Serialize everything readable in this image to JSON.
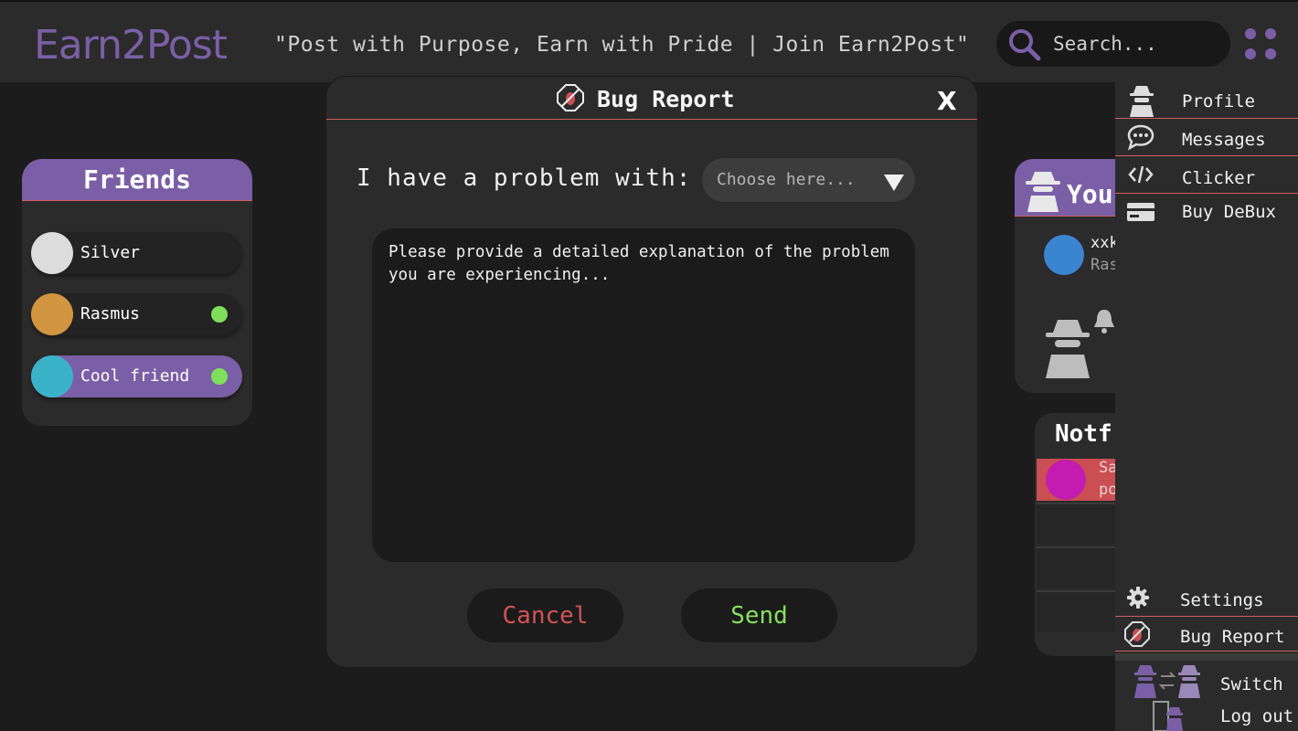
{
  "header": {
    "logo": "Earn2Post",
    "tagline": "\"Post with Purpose, Earn with Pride | Join Earn2Post\"",
    "search_placeholder": "Search...",
    "brand_color": "#7a5fa6"
  },
  "friends": {
    "title": "Friends",
    "items": [
      {
        "name": "Silver",
        "avatar_color": "#dcdcdc",
        "online": false
      },
      {
        "name": "Rasmus",
        "avatar_color": "#d29640",
        "online": true
      },
      {
        "name": "Cool friend",
        "avatar_color": "#3ab3c8",
        "online": true
      }
    ]
  },
  "you_panel": {
    "title": "You",
    "entry_name": "xxk",
    "entry_sub": "Ras"
  },
  "notifications": {
    "title": "Notf",
    "first_line1": "Sa",
    "first_line2": "po"
  },
  "side_menu": {
    "items": [
      {
        "label": "Profile",
        "icon": "spy-icon"
      },
      {
        "label": "Messages",
        "icon": "chat-icon"
      },
      {
        "label": "Clicker",
        "icon": "code-icon"
      },
      {
        "label": "Buy DeBux",
        "icon": "card-icon"
      }
    ],
    "bottom_items": [
      {
        "label": "Settings",
        "icon": "gear-icon"
      },
      {
        "label": "Bug Report",
        "icon": "bug-icon"
      },
      {
        "label": "Switch",
        "icon": "switch-user-icon"
      },
      {
        "label": "Log out",
        "icon": "logout-icon"
      }
    ]
  },
  "modal": {
    "title": "Bug Report",
    "close_label": "X",
    "problem_label": "I have a problem with:",
    "select_value": "Choose here...",
    "textarea_placeholder": "Please provide a detailed explanation of the problem you are experiencing...",
    "cancel_label": "Cancel",
    "send_label": "Send"
  }
}
